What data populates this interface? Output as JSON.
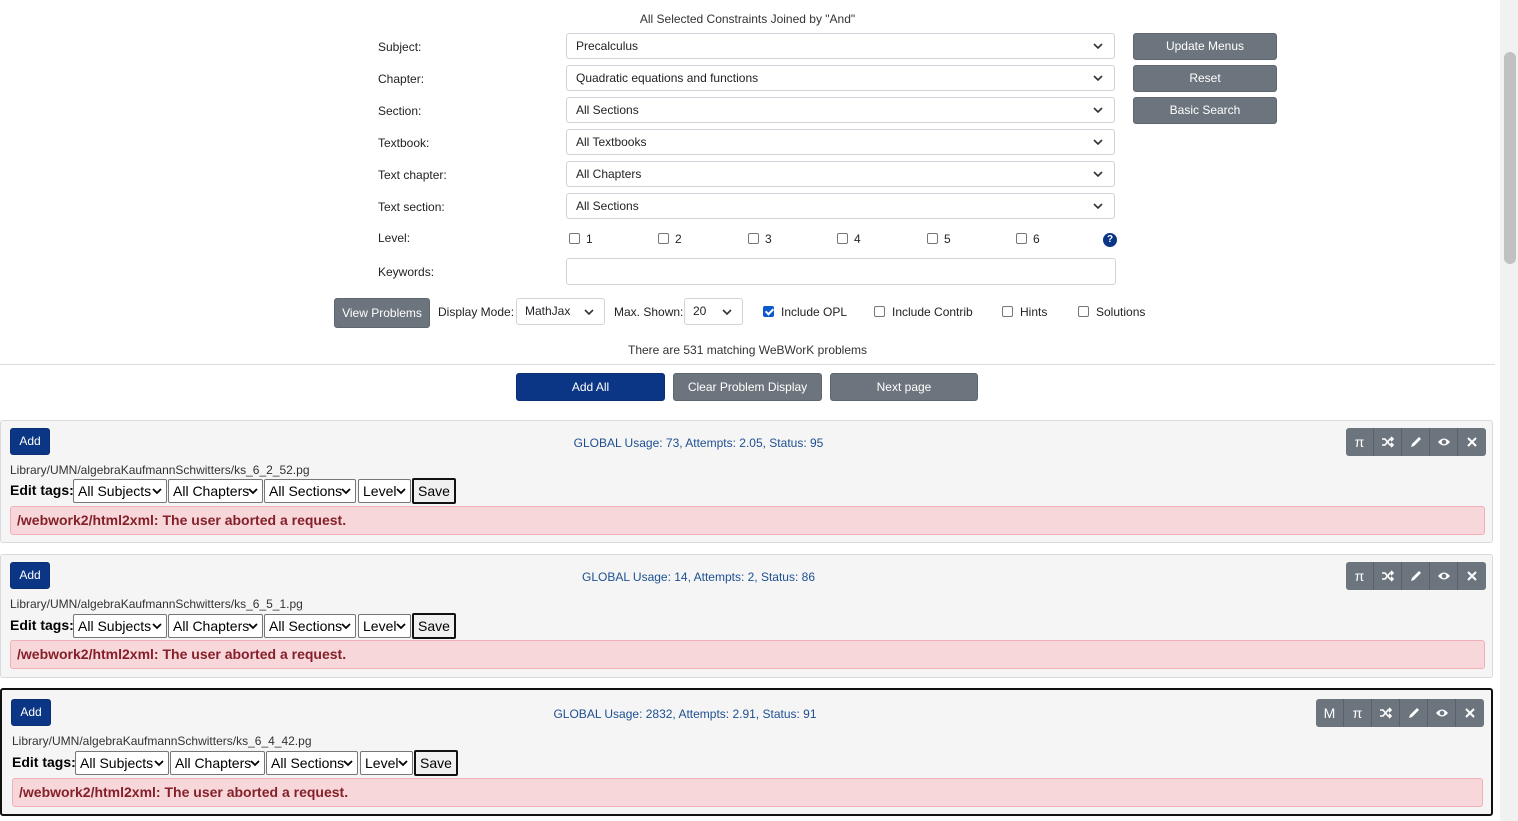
{
  "header_note": "All Selected Constraints Joined by \"And\"",
  "filters": [
    {
      "label": "Subject:",
      "value": "Precalculus"
    },
    {
      "label": "Chapter:",
      "value": "Quadratic equations and functions"
    },
    {
      "label": "Section:",
      "value": "All Sections"
    },
    {
      "label": "Textbook:",
      "value": "All Textbooks"
    },
    {
      "label": "Text chapter:",
      "value": "All Chapters"
    },
    {
      "label": "Text section:",
      "value": "All Sections"
    }
  ],
  "side_buttons": {
    "update": "Update Menus",
    "reset": "Reset",
    "basic": "Basic Search"
  },
  "level": {
    "label": "Level:",
    "options": [
      "1",
      "2",
      "3",
      "4",
      "5",
      "6"
    ],
    "help": "?"
  },
  "keywords": {
    "label": "Keywords:",
    "value": ""
  },
  "controls": {
    "view": "View Problems",
    "display_mode_label": "Display Mode:",
    "display_mode_value": "MathJax",
    "max_shown_label": "Max. Shown:",
    "max_shown_value": "20",
    "include_opl": "Include OPL",
    "include_opl_checked": true,
    "include_contrib": "Include Contrib",
    "hints": "Hints",
    "solutions": "Solutions"
  },
  "match_text": "There are 531 matching WeBWorK problems",
  "actions": {
    "add_all": "Add All",
    "clear": "Clear Problem Display",
    "next": "Next page"
  },
  "problems": [
    {
      "add": "Add",
      "usage": "GLOBAL Usage: 73, Attempts: 2.05, Status: 95",
      "path": "Library/UMN/algebraKaufmannSchwitters/ks_6_2_52.pg",
      "edit_label": "Edit tags:",
      "tag_subject": "All Subjects",
      "tag_chapter": "All Chapters",
      "tag_section": "All Sections",
      "tag_level": "Level",
      "save": "Save",
      "error": "/webwork2/html2xml: The user aborted a request."
    },
    {
      "add": "Add",
      "usage": "GLOBAL Usage: 14, Attempts: 2, Status: 86",
      "path": "Library/UMN/algebraKaufmannSchwitters/ks_6_5_1.pg",
      "edit_label": "Edit tags:",
      "tag_subject": "All Subjects",
      "tag_chapter": "All Chapters",
      "tag_section": "All Sections",
      "tag_level": "Level",
      "save": "Save",
      "error": "/webwork2/html2xml: The user aborted a request."
    },
    {
      "add": "Add",
      "usage": "GLOBAL Usage: 2832, Attempts: 2.91, Status: 91",
      "path": "Library/UMN/algebraKaufmannSchwitters/ks_6_4_42.pg",
      "edit_label": "Edit tags:",
      "tag_subject": "All Subjects",
      "tag_chapter": "All Chapters",
      "tag_section": "All Sections",
      "tag_level": "Level",
      "save": "Save",
      "error": "/webwork2/html2xml: The user aborted a request.",
      "m_label": "M"
    }
  ],
  "tool_icons": [
    "pi-icon",
    "shuffle-icon",
    "pencil-icon",
    "eye-icon",
    "close-icon"
  ],
  "pi_glyph": "π",
  "colors": {
    "primary": "#0b3685",
    "secondary": "#6c757d",
    "alert_bg": "#f8d7da",
    "alert_text": "#842029",
    "usage_text": "#1d4f91"
  }
}
